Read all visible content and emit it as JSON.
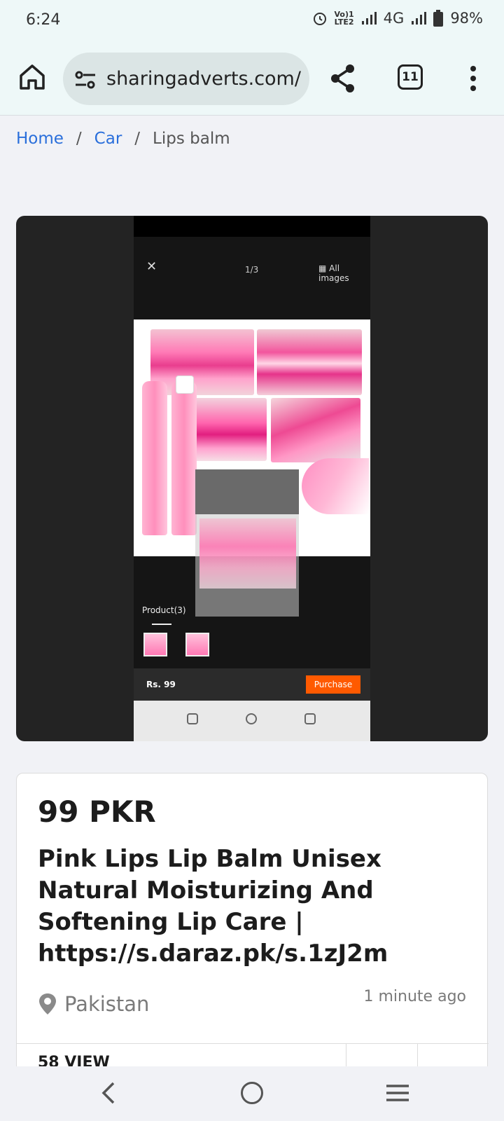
{
  "status": {
    "time": "6:24",
    "network_top": "Vo)1",
    "network_bottom": "LTE2",
    "net": "4G",
    "battery": "98%"
  },
  "browser": {
    "url": "sharingadverts.com/",
    "tab_count": "11"
  },
  "breadcrumb": {
    "home": "Home",
    "sep": "/",
    "category": "Car",
    "current": "Lips balm"
  },
  "image_viewer": {
    "counter": "1/3",
    "all_images": "All images",
    "tab_product": "Product(3)",
    "price": "Rs. 99",
    "purchase": "Purchase"
  },
  "listing": {
    "price": "99 PKR",
    "title": "Pink Lips Lip Balm Unisex Natural Moisturizing And Softening Lip Care | https://s.daraz.pk/s.1zJ2m",
    "location": "Pakistan",
    "posted": "1 minute ago",
    "views": "58 VIEW"
  }
}
